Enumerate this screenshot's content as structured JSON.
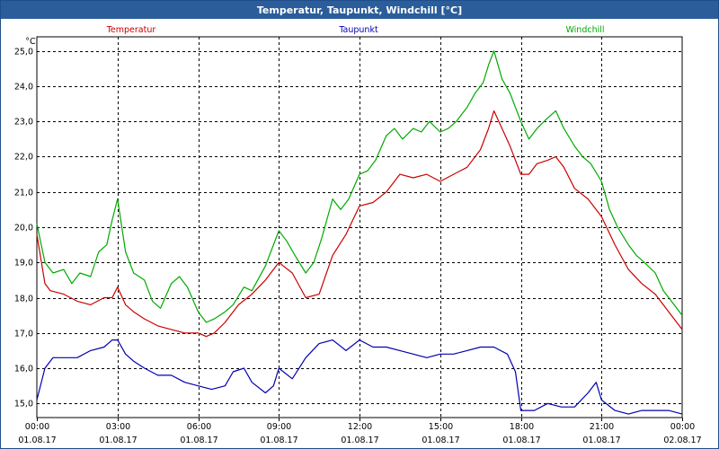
{
  "window": {
    "title": "Temperatur, Taupunkt, Windchill [°C]"
  },
  "colors": {
    "titlebar": "#2a5d9a",
    "temperatur": "#cc0000",
    "taupunkt": "#0000b0",
    "windchill": "#00aa00",
    "grid": "#000000"
  },
  "chart_data": {
    "type": "line",
    "title": "Temperatur, Taupunkt, Windchill [°C]",
    "ylabel": "°C",
    "xlabel": "",
    "xlim": [
      0,
      24
    ],
    "ylim": [
      14.6,
      25.4
    ],
    "grid": true,
    "legend_position": "top",
    "yticks": [
      15.0,
      16.0,
      17.0,
      18.0,
      19.0,
      20.0,
      21.0,
      22.0,
      23.0,
      24.0,
      25.0
    ],
    "ytick_labels": [
      "15,0",
      "16,0",
      "17,0",
      "18,0",
      "19,0",
      "20,0",
      "21,0",
      "22,0",
      "23,0",
      "24,0",
      "25,0"
    ],
    "xticks": [
      0,
      3,
      6,
      9,
      12,
      15,
      18,
      21,
      24
    ],
    "xtick_labels": [
      [
        "00:00",
        "01.08.17"
      ],
      [
        "03:00",
        "01.08.17"
      ],
      [
        "06:00",
        "01.08.17"
      ],
      [
        "09:00",
        "01.08.17"
      ],
      [
        "12:00",
        "01.08.17"
      ],
      [
        "15:00",
        "01.08.17"
      ],
      [
        "18:00",
        "01.08.17"
      ],
      [
        "21:00",
        "01.08.17"
      ],
      [
        "00:00",
        "02.08.17"
      ]
    ],
    "series": [
      {
        "name": "Temperatur",
        "color": "#cc0000",
        "x": [
          0.0,
          0.3,
          0.5,
          1.0,
          1.5,
          2.0,
          2.5,
          2.8,
          3.0,
          3.3,
          3.6,
          4.0,
          4.5,
          5.0,
          5.5,
          6.0,
          6.3,
          6.6,
          7.0,
          7.5,
          8.0,
          8.5,
          9.0,
          9.5,
          10.0,
          10.5,
          11.0,
          11.5,
          12.0,
          12.5,
          13.0,
          13.5,
          14.0,
          14.5,
          15.0,
          15.5,
          16.0,
          16.5,
          16.8,
          17.0,
          17.3,
          17.6,
          18.0,
          18.3,
          18.6,
          19.0,
          19.3,
          19.6,
          20.0,
          20.5,
          21.0,
          21.5,
          22.0,
          22.5,
          23.0,
          23.5,
          24.0
        ],
        "y": [
          19.8,
          18.4,
          18.2,
          18.1,
          17.9,
          17.8,
          18.0,
          18.0,
          18.3,
          17.8,
          17.6,
          17.4,
          17.2,
          17.1,
          17.0,
          17.0,
          16.9,
          17.0,
          17.3,
          17.8,
          18.1,
          18.5,
          19.0,
          18.7,
          18.0,
          18.1,
          19.2,
          19.8,
          20.6,
          20.7,
          21.0,
          21.5,
          21.4,
          21.5,
          21.3,
          21.5,
          21.7,
          22.2,
          22.8,
          23.3,
          22.8,
          22.3,
          21.5,
          21.5,
          21.8,
          21.9,
          22.0,
          21.7,
          21.1,
          20.8,
          20.3,
          19.5,
          18.8,
          18.4,
          18.1,
          17.6,
          17.1
        ]
      },
      {
        "name": "Taupunkt",
        "color": "#0000b0",
        "x": [
          0.0,
          0.3,
          0.6,
          1.0,
          1.5,
          2.0,
          2.5,
          2.8,
          3.0,
          3.3,
          3.6,
          4.0,
          4.5,
          5.0,
          5.5,
          6.0,
          6.5,
          7.0,
          7.3,
          7.7,
          8.0,
          8.5,
          8.8,
          9.0,
          9.5,
          10.0,
          10.5,
          11.0,
          11.5,
          12.0,
          12.5,
          13.0,
          13.5,
          14.0,
          14.5,
          15.0,
          15.5,
          16.0,
          16.5,
          17.0,
          17.5,
          17.8,
          18.0,
          18.5,
          19.0,
          19.5,
          20.0,
          20.5,
          20.8,
          21.0,
          21.5,
          22.0,
          22.5,
          23.0,
          23.5,
          24.0
        ],
        "y": [
          15.1,
          16.0,
          16.3,
          16.3,
          16.3,
          16.5,
          16.6,
          16.8,
          16.8,
          16.4,
          16.2,
          16.0,
          15.8,
          15.8,
          15.6,
          15.5,
          15.4,
          15.5,
          15.9,
          16.0,
          15.6,
          15.3,
          15.5,
          16.0,
          15.7,
          16.3,
          16.7,
          16.8,
          16.5,
          16.8,
          16.6,
          16.6,
          16.5,
          16.4,
          16.3,
          16.4,
          16.4,
          16.5,
          16.6,
          16.6,
          16.4,
          15.9,
          14.8,
          14.8,
          15.0,
          14.9,
          14.9,
          15.3,
          15.6,
          15.1,
          14.8,
          14.7,
          14.8,
          14.8,
          14.8,
          14.7
        ]
      },
      {
        "name": "Windchill",
        "color": "#00aa00",
        "x": [
          0.0,
          0.3,
          0.6,
          1.0,
          1.3,
          1.6,
          2.0,
          2.3,
          2.6,
          2.8,
          3.0,
          3.3,
          3.6,
          4.0,
          4.3,
          4.6,
          5.0,
          5.3,
          5.6,
          6.0,
          6.3,
          6.6,
          7.0,
          7.3,
          7.7,
          8.0,
          8.5,
          9.0,
          9.3,
          9.6,
          10.0,
          10.3,
          10.6,
          11.0,
          11.3,
          11.6,
          12.0,
          12.3,
          12.6,
          13.0,
          13.3,
          13.6,
          14.0,
          14.3,
          14.6,
          15.0,
          15.3,
          15.6,
          16.0,
          16.3,
          16.6,
          16.8,
          17.0,
          17.3,
          17.6,
          18.0,
          18.3,
          18.6,
          19.0,
          19.3,
          19.6,
          20.0,
          20.3,
          20.6,
          21.0,
          21.3,
          21.6,
          22.0,
          22.3,
          22.6,
          23.0,
          23.3,
          23.6,
          24.0
        ],
        "y": [
          20.1,
          19.0,
          18.7,
          18.8,
          18.4,
          18.7,
          18.6,
          19.3,
          19.5,
          20.2,
          20.8,
          19.3,
          18.7,
          18.5,
          17.9,
          17.7,
          18.4,
          18.6,
          18.3,
          17.6,
          17.3,
          17.4,
          17.6,
          17.8,
          18.3,
          18.2,
          18.9,
          19.9,
          19.6,
          19.2,
          18.7,
          19.0,
          19.7,
          20.8,
          20.5,
          20.8,
          21.5,
          21.6,
          21.9,
          22.6,
          22.8,
          22.5,
          22.8,
          22.7,
          23.0,
          22.7,
          22.8,
          23.0,
          23.4,
          23.8,
          24.1,
          24.6,
          25.0,
          24.2,
          23.8,
          23.0,
          22.5,
          22.8,
          23.1,
          23.3,
          22.8,
          22.3,
          22.0,
          21.8,
          21.3,
          20.5,
          20.0,
          19.5,
          19.2,
          19.0,
          18.7,
          18.2,
          17.9,
          17.5
        ]
      }
    ]
  }
}
